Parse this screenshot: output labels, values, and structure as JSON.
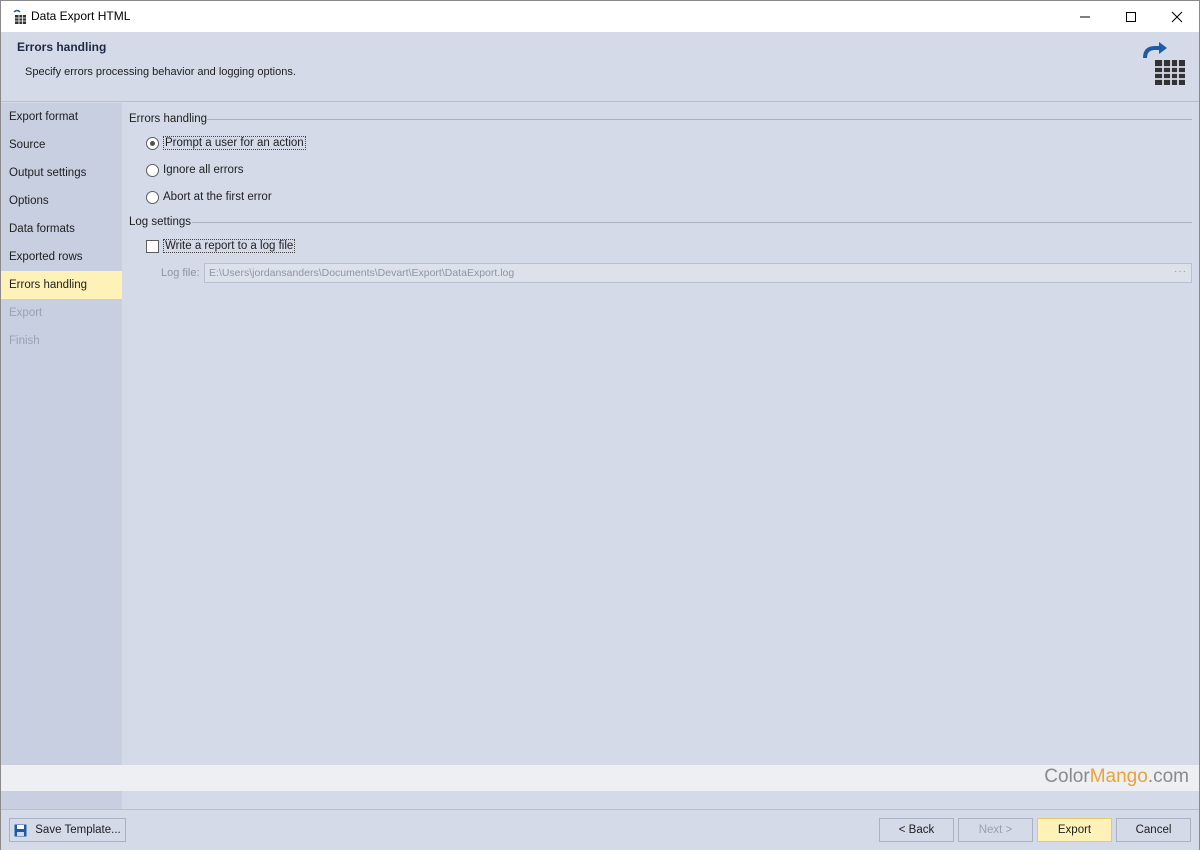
{
  "window": {
    "title": "Data Export HTML"
  },
  "header": {
    "title": "Errors handling",
    "subtitle": "Specify errors processing behavior and logging options."
  },
  "sidebar": {
    "items": [
      {
        "label": "Export format",
        "state": "normal"
      },
      {
        "label": "Source",
        "state": "normal"
      },
      {
        "label": "Output settings",
        "state": "normal"
      },
      {
        "label": "Options",
        "state": "normal"
      },
      {
        "label": "Data formats",
        "state": "normal"
      },
      {
        "label": "Exported rows",
        "state": "normal"
      },
      {
        "label": "Errors handling",
        "state": "active"
      },
      {
        "label": "Export",
        "state": "disabled"
      },
      {
        "label": "Finish",
        "state": "disabled"
      }
    ]
  },
  "errors_group": {
    "label": "Errors handling",
    "options": [
      {
        "label": "Prompt a user for an action",
        "selected": true
      },
      {
        "label": "Ignore all errors",
        "selected": false
      },
      {
        "label": "Abort at the first error",
        "selected": false
      }
    ]
  },
  "log_group": {
    "label": "Log settings",
    "write_report_label": "Write a report to a log file",
    "write_report_checked": false,
    "log_file_label": "Log file:",
    "log_file_value": "E:\\Users\\jordansanders\\Documents\\Devart\\Export\\DataExport.log",
    "browse_label": "···"
  },
  "watermark": {
    "part1": "Color",
    "part2": "Mango",
    "part3": ".com"
  },
  "footer": {
    "save_template_label": "Save Template...",
    "back_label": "< Back",
    "next_label": "Next >",
    "export_label": "Export",
    "cancel_label": "Cancel"
  },
  "colors": {
    "background": "#d4dae8",
    "sidebar": "#c8cfe0",
    "active_highlight": "#fff2b8",
    "accent_blue": "#1f5aa6"
  }
}
